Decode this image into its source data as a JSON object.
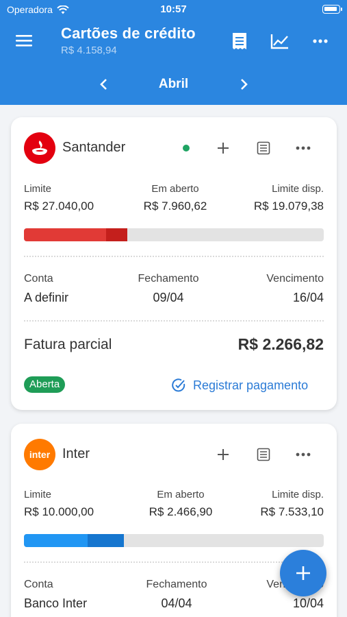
{
  "status": {
    "carrier": "Operadora",
    "time": "10:57"
  },
  "header": {
    "title": "Cartões de crédito",
    "subtitle": "R$ 4.158,94",
    "month": "Abril"
  },
  "cards": [
    {
      "bank": "Santander",
      "limite_label": "Limite",
      "limite": "R$ 27.040,00",
      "aberto_label": "Em aberto",
      "aberto": "R$ 7.960,62",
      "disp_label": "Limite disp.",
      "disp": "R$ 19.079,38",
      "usage_fraction": 0.344,
      "conta_label": "Conta",
      "conta": "A definir",
      "fechamento_label": "Fechamento",
      "fechamento": "09/04",
      "vencimento_label": "Vencimento",
      "vencimento": "16/04",
      "fatura_label": "Fatura parcial",
      "fatura": "R$ 2.266,82",
      "status_badge": "Aberta",
      "pay_label": "Registrar pagamento",
      "colors": {
        "bar_main": "#e13a36",
        "bar_accent": "#c41f1c",
        "logo": "#e3000f"
      }
    },
    {
      "bank": "Inter",
      "logo_text": "inter",
      "limite_label": "Limite",
      "limite": "R$ 10.000,00",
      "aberto_label": "Em aberto",
      "aberto": "R$ 2.466,90",
      "disp_label": "Limite disp.",
      "disp": "R$ 7.533,10",
      "usage_fraction": 0.335,
      "conta_label": "Conta",
      "conta": "Banco Inter",
      "fechamento_label": "Fechamento",
      "fechamento": "04/04",
      "vencimento_label": "Vencimento",
      "vencimento": "10/04",
      "colors": {
        "bar_main": "#2196f3",
        "bar_accent": "#1676cf",
        "logo": "#ff7a00"
      }
    }
  ],
  "icons": {
    "menu": "menu-icon",
    "receipt": "receipt-icon",
    "chart": "chart-icon",
    "more": "more-icon",
    "add": "plus-icon",
    "list": "list-icon",
    "check": "check-circle-icon",
    "fab": "plus-icon"
  }
}
